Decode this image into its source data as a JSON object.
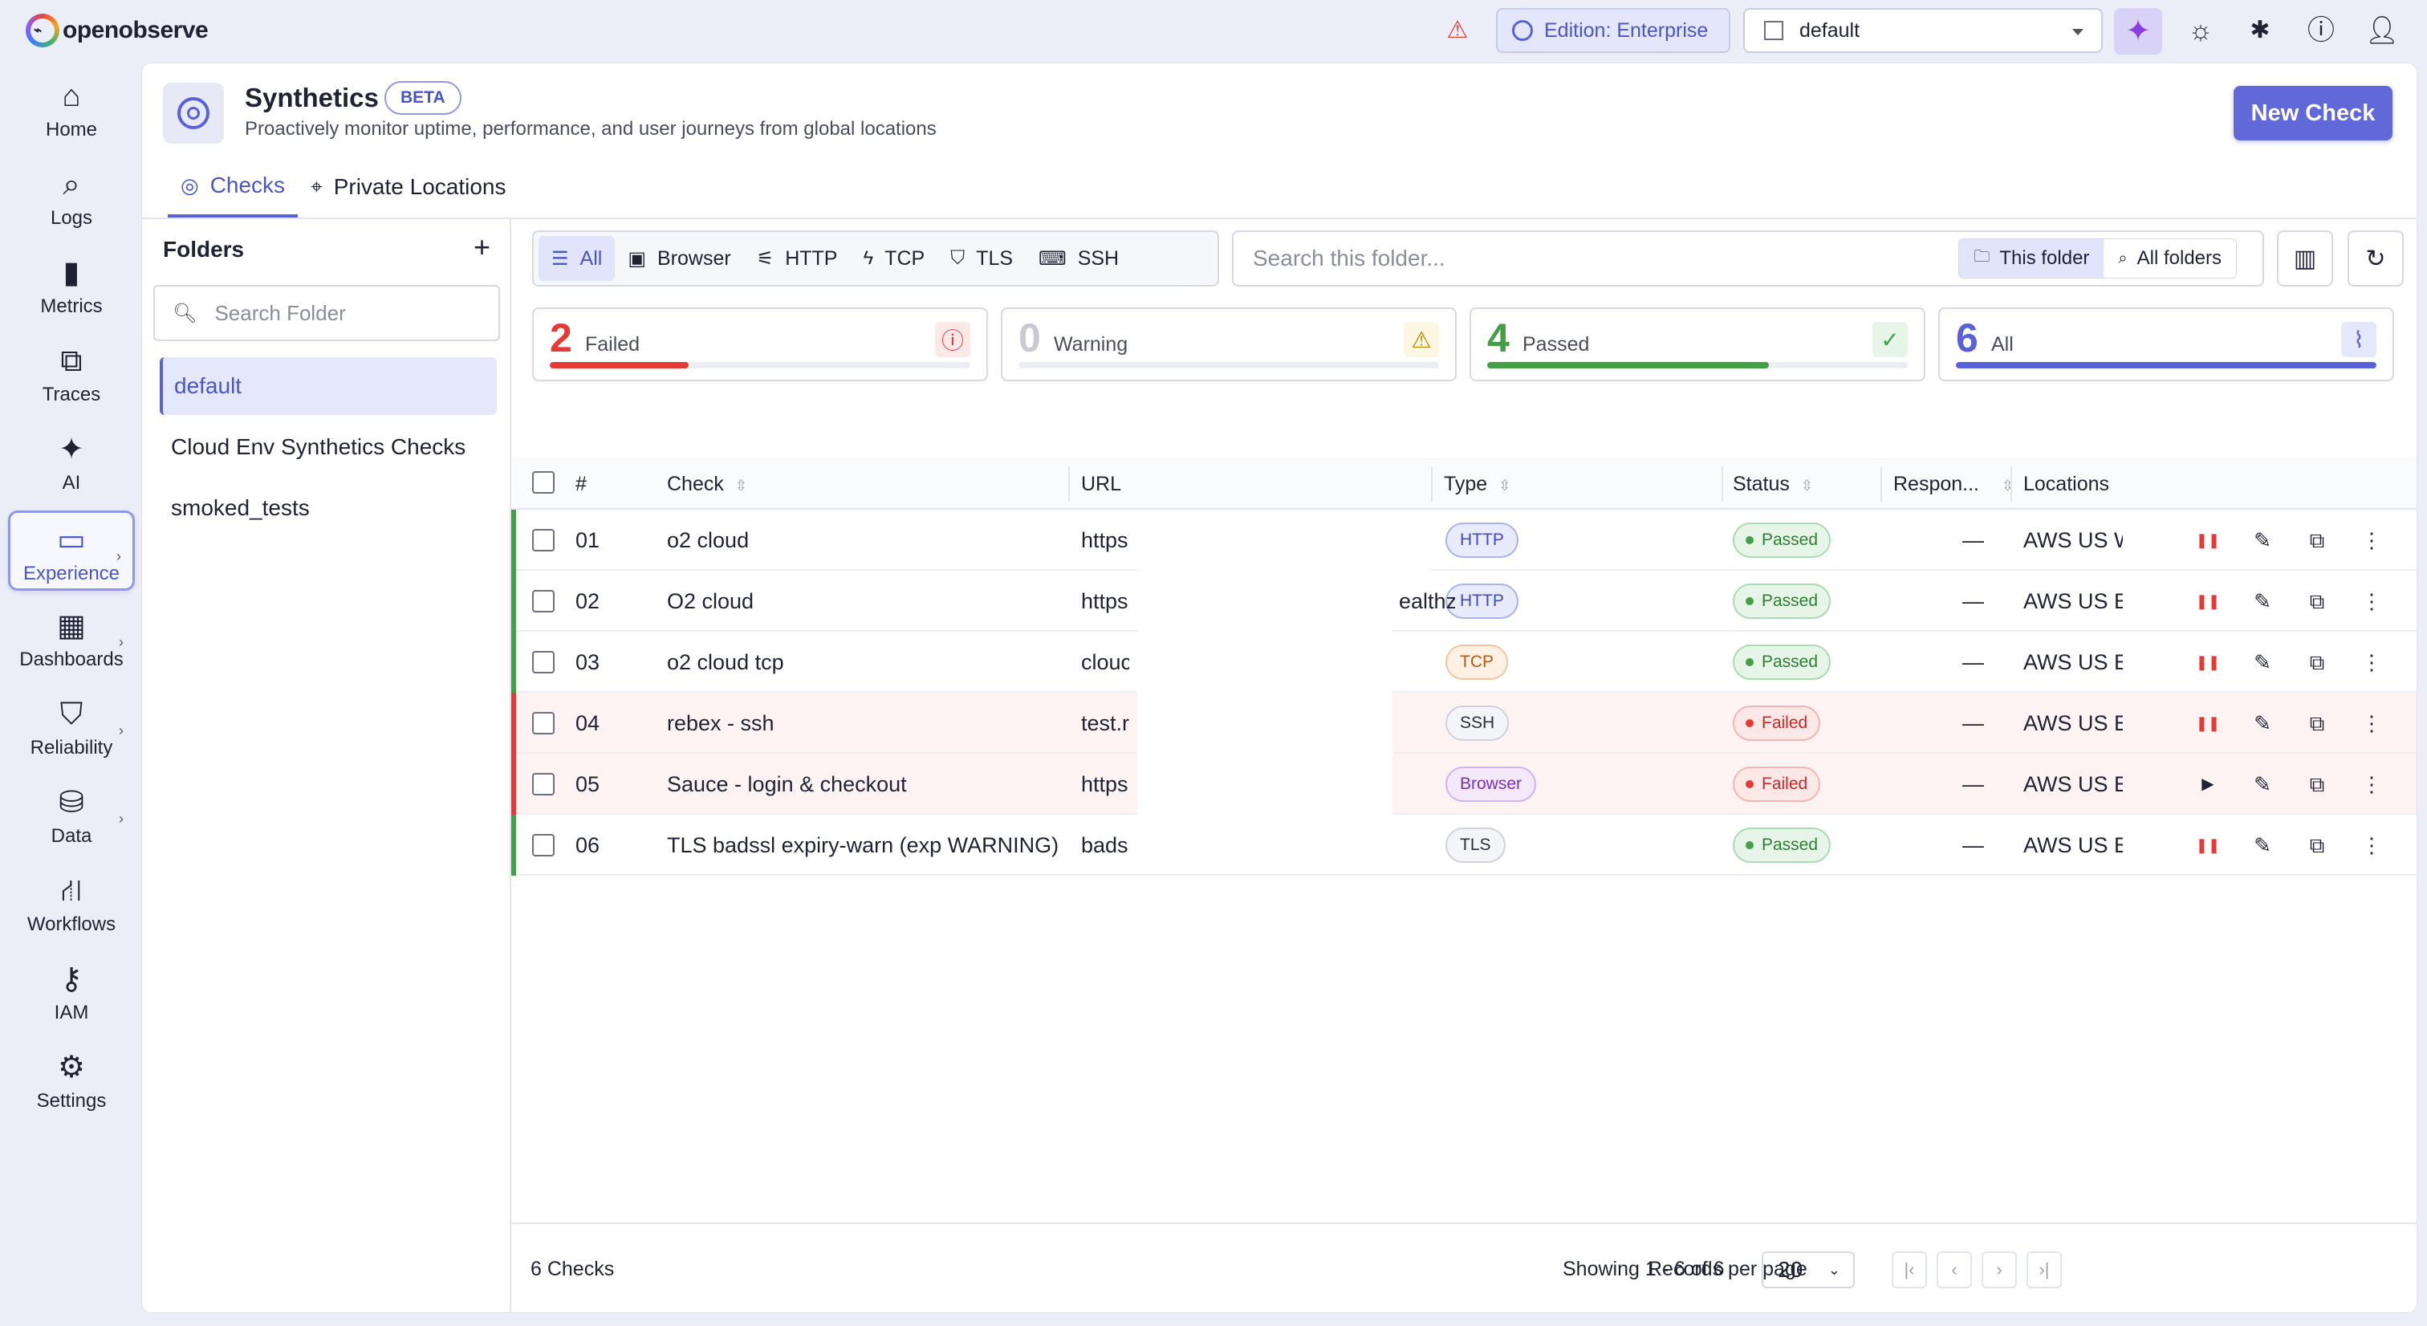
{
  "app": {
    "name": "openobserve"
  },
  "topbar": {
    "edition_label": "Edition: Enterprise",
    "org_selected": "default"
  },
  "nav": [
    {
      "label": "Home",
      "icon": "home-icon"
    },
    {
      "label": "Logs",
      "icon": "search-icon"
    },
    {
      "label": "Metrics",
      "icon": "bar-chart-icon"
    },
    {
      "label": "Traces",
      "icon": "traces-icon"
    },
    {
      "label": "AI",
      "icon": "sparkle-icon"
    },
    {
      "label": "Experience",
      "icon": "devices-icon"
    },
    {
      "label": "Dashboards",
      "icon": "dashboard-icon"
    },
    {
      "label": "Reliability",
      "icon": "shield-icon"
    },
    {
      "label": "Data",
      "icon": "database-icon"
    },
    {
      "label": "Workflows",
      "icon": "workflow-icon"
    },
    {
      "label": "IAM",
      "icon": "user-key-icon"
    },
    {
      "label": "Settings",
      "icon": "gear-icon"
    }
  ],
  "page": {
    "title": "Synthetics",
    "badge": "BETA",
    "subtitle": "Proactively monitor uptime, performance, and user journeys from global locations",
    "new_button": "New Check",
    "tabs": [
      "Checks",
      "Private Locations"
    ]
  },
  "folders": {
    "heading": "Folders",
    "search_placeholder": "Search Folder",
    "items": [
      "default",
      "Cloud Env Synthetics Checks",
      "smoked_tests"
    ]
  },
  "filters": {
    "types": [
      "All",
      "Browser",
      "HTTP",
      "TCP",
      "TLS",
      "SSH"
    ],
    "search_placeholder": "Search this folder...",
    "scope": [
      "This folder",
      "All folders"
    ]
  },
  "summary": [
    {
      "count": "2",
      "label": "Failed",
      "color": "#e53935",
      "fill_fraction": 0.33
    },
    {
      "count": "0",
      "label": "Warning",
      "color": "#c8c9d2",
      "fill_fraction": 0
    },
    {
      "count": "4",
      "label": "Passed",
      "color": "#43a047",
      "fill_fraction": 0.67
    },
    {
      "count": "6",
      "label": "All",
      "color": "#5862d6",
      "fill_fraction": 1.0
    }
  ],
  "table": {
    "columns": [
      "#",
      "Check",
      "URL",
      "Type",
      "Status",
      "Respon...",
      "Locations"
    ],
    "rows": [
      {
        "num": "01",
        "check": "o2 cloud",
        "url": "https",
        "url_tail": "",
        "type": "HTTP",
        "status": "Passed",
        "response": "—",
        "location": "AWS US W..."
      },
      {
        "num": "02",
        "check": "O2 cloud",
        "url": "https",
        "url_tail": "ealthz",
        "type": "HTTP",
        "status": "Passed",
        "response": "—",
        "location": "AWS US Ea"
      },
      {
        "num": "03",
        "check": "o2 cloud tcp",
        "url": "clouc",
        "url_tail": "",
        "type": "TCP",
        "status": "Passed",
        "response": "—",
        "location": "AWS US Ea"
      },
      {
        "num": "04",
        "check": "rebex - ssh",
        "url": "test.r",
        "url_tail": "",
        "type": "SSH",
        "status": "Failed",
        "response": "—",
        "location": "AWS US Ea"
      },
      {
        "num": "05",
        "check": "Sauce - login & checkout",
        "url": "https",
        "url_tail": "",
        "type": "Browser",
        "status": "Failed",
        "response": "—",
        "location": "AWS US Ea"
      },
      {
        "num": "06",
        "check": "TLS badssl expiry-warn (exp WARNING)",
        "url": "bads",
        "url_tail": "",
        "type": "TLS",
        "status": "Passed",
        "response": "—",
        "location": "AWS US Ea"
      }
    ]
  },
  "footer": {
    "total": "6 Checks",
    "showing": "Showing 1 - 6 of 6",
    "rpp_label": "Records per page",
    "rpp_value": "20"
  }
}
